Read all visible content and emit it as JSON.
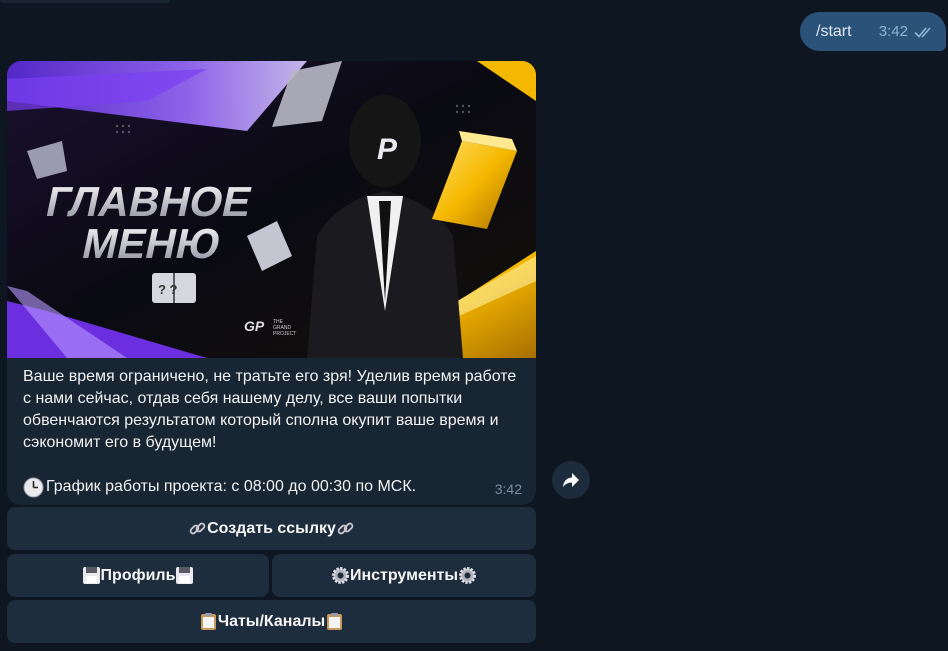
{
  "outgoing": {
    "text": "/start",
    "time": "3:42"
  },
  "incoming": {
    "banner": {
      "title_line1": "ГЛАВНОЕ",
      "title_line2": "МЕНЮ",
      "logo_text1": "THE",
      "logo_text2": "GRAND",
      "logo_text3": "PROJECT"
    },
    "text": "Ваше время ограничено, не тратьте его зря! Уделив время работе с нами сейчас, отдав себя нашему делу, все ваши попытки обвенчаются результатом который сполна окупит ваше время и сэкономит его в будущем!",
    "schedule": "График работы проекта: с 08:00 до 00:30 по МСК.",
    "time": "3:42"
  },
  "keyboard": {
    "create_link": "Создать ссылку",
    "profile": "Профиль",
    "tools": "Инструменты",
    "chats": "Чаты/Каналы"
  },
  "colors": {
    "background": "#0e1621",
    "incoming_bubble": "#182533",
    "outgoing_bubble": "#2b5278",
    "button": "#1d2d3d"
  }
}
